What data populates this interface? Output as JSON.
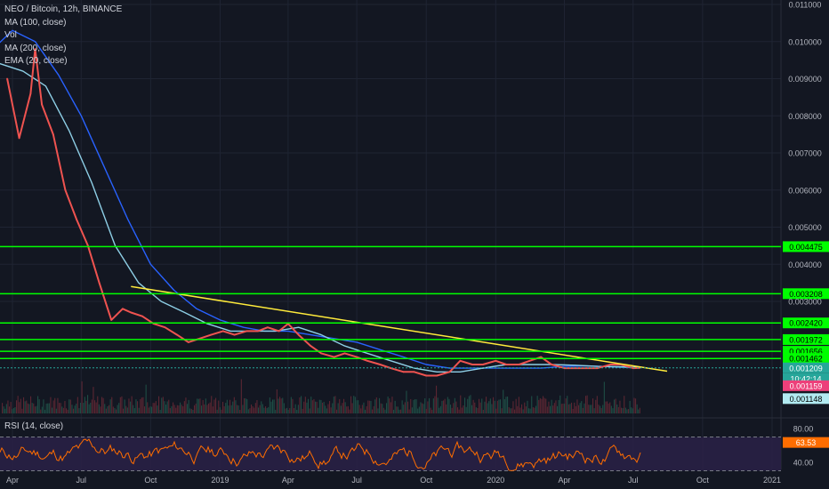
{
  "legend": {
    "symbol": "NEO / Bitcoin, 12h, BINANCE",
    "ma100": "MA (100, close)",
    "vol": "Vol",
    "ma200": "MA (200, close)",
    "ema20": "EMA (20, close)"
  },
  "rsi_legend": "RSI (14, close)",
  "colors": {
    "background": "#131722",
    "horizontal_lines": "#00ff00",
    "trendline": "#ffeb3b",
    "price": "#ef5350",
    "ma100": "#8ecfe6",
    "ma200": "#2962ff",
    "rsi": "#ff6d00",
    "rsi_band": "#2a2146"
  },
  "chart_data": {
    "type": "line",
    "x_ticks": [
      "Apr",
      "Jul",
      "Oct",
      "2019",
      "Apr",
      "Jul",
      "Oct",
      "2020",
      "Apr",
      "Jul",
      "Oct",
      "2021"
    ],
    "y_ticks": [
      "0.011000",
      "0.010000",
      "0.009000",
      "0.008000",
      "0.007000",
      "0.006000",
      "0.005000",
      "0.004000",
      "0.003000"
    ],
    "horizontal_levels": [
      "0.004475",
      "0.003208",
      "0.002420",
      "0.001972",
      "0.001656",
      "0.001462"
    ],
    "price_labels": {
      "last": "0.001209",
      "countdown": "10:42:14",
      "ema": "0.001159",
      "ma": "0.001148"
    },
    "rsi": {
      "ticks": [
        "80.00",
        "40.00"
      ],
      "last": "63.53",
      "upper": 70,
      "lower": 30
    },
    "price_series": {
      "name": "NEO / Bitcoin",
      "x": [
        "2018-03-25",
        "2018-04-10",
        "2018-04-25",
        "2018-05-01",
        "2018-05-10",
        "2018-05-25",
        "2018-06-10",
        "2018-06-25",
        "2018-07-10",
        "2018-07-25",
        "2018-08-10",
        "2018-08-25",
        "2018-09-05",
        "2018-09-20",
        "2018-10-05",
        "2018-10-20",
        "2018-11-05",
        "2018-11-20",
        "2018-12-05",
        "2018-12-20",
        "2019-01-05",
        "2019-01-20",
        "2019-02-05",
        "2019-02-20",
        "2019-03-05",
        "2019-03-20",
        "2019-04-01",
        "2019-04-15",
        "2019-05-01",
        "2019-05-15",
        "2019-06-01",
        "2019-06-15",
        "2019-07-01",
        "2019-07-15",
        "2019-08-01",
        "2019-08-15",
        "2019-09-01",
        "2019-09-15",
        "2019-10-01",
        "2019-10-15",
        "2019-11-01",
        "2019-11-15",
        "2019-12-01",
        "2019-12-15",
        "2020-01-01",
        "2020-01-15",
        "2020-02-01",
        "2020-02-15",
        "2020-03-01",
        "2020-03-15",
        "2020-04-01",
        "2020-04-15",
        "2020-05-01",
        "2020-05-15",
        "2020-06-01",
        "2020-06-15",
        "2020-07-01",
        "2020-07-10"
      ],
      "values": [
        0.009,
        0.0074,
        0.0086,
        0.0098,
        0.0083,
        0.0075,
        0.006,
        0.0052,
        0.0045,
        0.0035,
        0.0025,
        0.0028,
        0.0027,
        0.0026,
        0.0024,
        0.0023,
        0.0021,
        0.0019,
        0.002,
        0.0021,
        0.0022,
        0.0021,
        0.0022,
        0.0022,
        0.0023,
        0.0022,
        0.0024,
        0.0021,
        0.0018,
        0.0016,
        0.0015,
        0.0016,
        0.0015,
        0.0014,
        0.0013,
        0.0012,
        0.0011,
        0.0011,
        0.001,
        0.001,
        0.0011,
        0.0014,
        0.0013,
        0.0013,
        0.0014,
        0.0013,
        0.0013,
        0.0014,
        0.0015,
        0.0013,
        0.0012,
        0.0012,
        0.0012,
        0.0012,
        0.0013,
        0.0013,
        0.0012,
        0.00121
      ]
    },
    "ma100_series": {
      "x": [
        "2018-03-01",
        "2018-04-15",
        "2018-05-15",
        "2018-06-15",
        "2018-07-15",
        "2018-08-15",
        "2018-09-15",
        "2018-10-15",
        "2018-11-15",
        "2018-12-15",
        "2019-01-15",
        "2019-02-15",
        "2019-03-15",
        "2019-04-15",
        "2019-05-15",
        "2019-06-15",
        "2019-07-15",
        "2019-08-15",
        "2019-09-15",
        "2019-10-15",
        "2019-11-15",
        "2019-12-15",
        "2020-01-15",
        "2020-02-15",
        "2020-03-15",
        "2020-04-15",
        "2020-05-15",
        "2020-06-15",
        "2020-07-10"
      ],
      "values": [
        0.0095,
        0.0092,
        0.0088,
        0.0076,
        0.0062,
        0.0045,
        0.0035,
        0.003,
        0.0027,
        0.0024,
        0.0022,
        0.0022,
        0.0022,
        0.0023,
        0.0021,
        0.0018,
        0.0016,
        0.0014,
        0.0012,
        0.0011,
        0.0011,
        0.0012,
        0.0013,
        0.0013,
        0.0013,
        0.00128,
        0.00125,
        0.00124,
        0.00122
      ]
    },
    "ma200_series": {
      "x": [
        "2018-03-01",
        "2018-04-01",
        "2018-05-01",
        "2018-06-01",
        "2018-07-01",
        "2018-08-01",
        "2018-09-01",
        "2018-10-01",
        "2018-11-01",
        "2018-12-01",
        "2019-01-01",
        "2019-02-01",
        "2019-03-01",
        "2019-04-01",
        "2019-05-01",
        "2019-06-01",
        "2019-07-01",
        "2019-08-01",
        "2019-09-01",
        "2019-10-01",
        "2019-11-01",
        "2019-12-01",
        "2020-01-01",
        "2020-02-01",
        "2020-03-01",
        "2020-04-01",
        "2020-05-01",
        "2020-06-01",
        "2020-07-10"
      ],
      "values": [
        0.0097,
        0.0103,
        0.01,
        0.0091,
        0.008,
        0.0066,
        0.0052,
        0.004,
        0.0033,
        0.0028,
        0.0025,
        0.0023,
        0.0022,
        0.0022,
        0.0021,
        0.002,
        0.0019,
        0.0017,
        0.0015,
        0.0013,
        0.0012,
        0.0012,
        0.0012,
        0.0012,
        0.0012,
        0.00125,
        0.00126,
        0.00124,
        0.0012
      ]
    },
    "trendline": {
      "x": [
        "2018-09-05",
        "2020-08-15"
      ],
      "values": [
        0.0034,
        0.00112
      ]
    }
  }
}
